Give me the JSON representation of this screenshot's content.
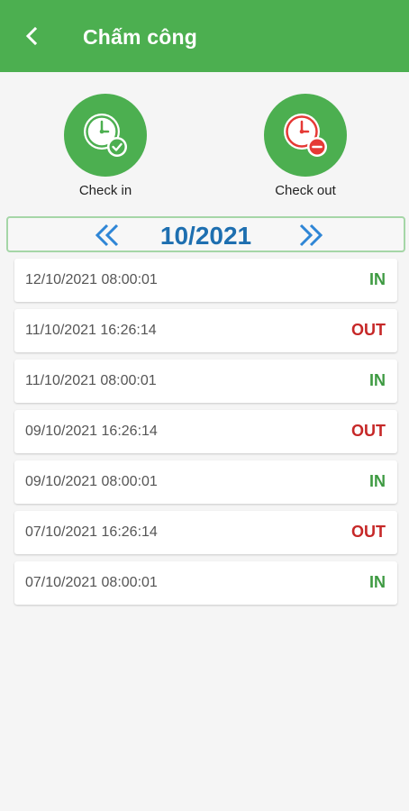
{
  "header": {
    "title": "Chấm công",
    "back_icon": "chevron-left-icon"
  },
  "actions": {
    "check_in": {
      "label": "Check in",
      "icon": "clock-check-icon",
      "color": "#4caf50",
      "badge_color": "#4caf50"
    },
    "check_out": {
      "label": "Check out",
      "icon": "clock-minus-icon",
      "color": "#4caf50",
      "badge_color": "#e53935"
    }
  },
  "month_selector": {
    "month": "10/2021",
    "prev_icon": "double-chevron-left-icon",
    "next_icon": "double-chevron-right-icon"
  },
  "records": [
    {
      "time": "12/10/2021 08:00:01",
      "type": "IN"
    },
    {
      "time": "11/10/2021 16:26:14",
      "type": "OUT"
    },
    {
      "time": "11/10/2021 08:00:01",
      "type": "IN"
    },
    {
      "time": "09/10/2021 16:26:14",
      "type": "OUT"
    },
    {
      "time": "09/10/2021 08:00:01",
      "type": "IN"
    },
    {
      "time": "07/10/2021 16:26:14",
      "type": "OUT"
    },
    {
      "time": "07/10/2021 08:00:01",
      "type": "IN"
    }
  ],
  "colors": {
    "primary": "#4caf50",
    "in": "#3e9a42",
    "out": "#c62828",
    "month": "#1e6fb0"
  }
}
